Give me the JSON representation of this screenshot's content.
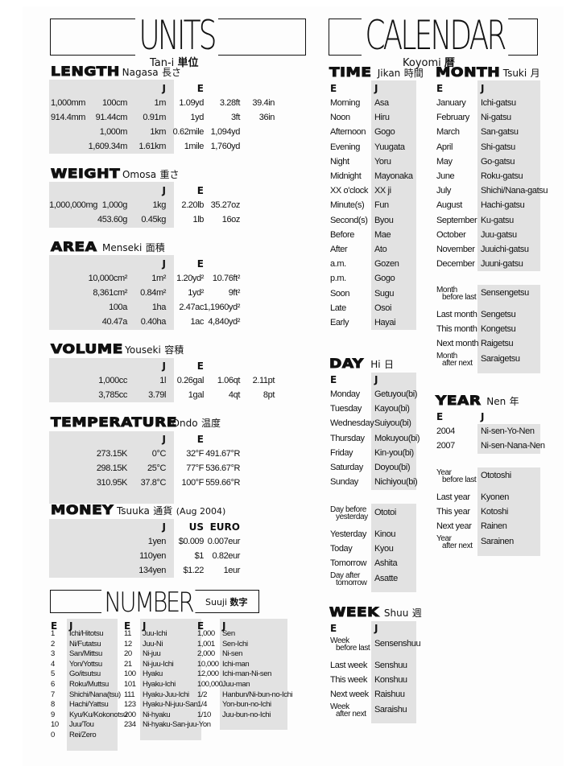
{
  "units": {
    "title": "UNITS",
    "subtitle_romaji": "Tan-i",
    "subtitle_kanji": "単位",
    "length": {
      "heading": "LENGTH",
      "romaji": "Nagasa",
      "kanji": "長さ",
      "col_j": "J",
      "col_e": "E",
      "rows": [
        [
          "1,000mm",
          "100cm",
          "1m",
          "1.09yd",
          "3.28ft",
          "39.4in"
        ],
        [
          "914.4mm",
          "91.44cm",
          "0.91m",
          "1yd",
          "3ft",
          "36in"
        ],
        [
          "",
          "1,000m",
          "1km",
          "0.62mile",
          "1,094yd",
          ""
        ],
        [
          "",
          "1,609.34m",
          "1.61km",
          "1mile",
          "1,760yd",
          ""
        ]
      ]
    },
    "weight": {
      "heading": "WEIGHT",
      "romaji": "Omosa",
      "kanji": "重さ",
      "col_j": "J",
      "col_e": "E",
      "rows": [
        [
          "1,000,000mg",
          "1,000g",
          "1kg",
          "2.20lb",
          "35.27oz"
        ],
        [
          "",
          "453.60g",
          "0.45kg",
          "1lb",
          "16oz"
        ]
      ]
    },
    "area": {
      "heading": "AREA",
      "romaji": "Menseki",
      "kanji": "面積",
      "col_j": "J",
      "col_e": "E",
      "rows": [
        [
          "10,000cm²",
          "1m²",
          "1.20yd²",
          "10.76ft²"
        ],
        [
          "8,361cm²",
          "0.84m²",
          "1yd²",
          "9ft²"
        ],
        [
          "100a",
          "1ha",
          "2.47ac",
          "1,1960yd²"
        ],
        [
          "40.47a",
          "0.40ha",
          "1ac",
          "4,840yd²"
        ]
      ]
    },
    "volume": {
      "heading": "VOLUME",
      "romaji": "Youseki",
      "kanji": "容積",
      "col_j": "J",
      "col_e": "E",
      "rows": [
        [
          "1,000cc",
          "1l",
          "0.26gal",
          "1.06qt",
          "2.11pt"
        ],
        [
          "3,785cc",
          "3.79l",
          "1gal",
          "4qt",
          "8pt"
        ]
      ]
    },
    "temperature": {
      "heading": "TEMPERATURE",
      "romaji": "Ondo",
      "kanji": "温度",
      "col_j": "J",
      "col_e": "E",
      "rows": [
        [
          "273.15K",
          "0°C",
          "32°F",
          "491.67°R"
        ],
        [
          "298.15K",
          "25°C",
          "77°F",
          "536.67°R"
        ],
        [
          "310.95K",
          "37.8°C",
          "100°F",
          "559.66°R"
        ]
      ]
    },
    "money": {
      "heading": "MONEY",
      "romaji": "Tsuuka",
      "kanji": "通貨",
      "note": "(Aug 2004)",
      "col_j": "J",
      "col_us": "US",
      "col_euro": "EURO",
      "rows": [
        [
          "1yen",
          "$0.009",
          "0.007eur"
        ],
        [
          "110yen",
          "$1",
          "0.82eur"
        ],
        [
          "134yen",
          "$1.22",
          "1eur"
        ]
      ]
    }
  },
  "number": {
    "title": "NUMBER",
    "romaji": "Suuji",
    "kanji": "数字",
    "col_e": "E",
    "col_j": "J",
    "col1": [
      [
        "1",
        "Ichi/Hitotsu"
      ],
      [
        "2",
        "Ni/Futatsu"
      ],
      [
        "3",
        "San/Mittsu"
      ],
      [
        "4",
        "Yon/Yottsu"
      ],
      [
        "5",
        "Go/itsutsu"
      ],
      [
        "6",
        "Roku/Muttsu"
      ],
      [
        "7",
        "Shichi/Nana(tsu)"
      ],
      [
        "8",
        "Hachi/Yattsu"
      ],
      [
        "9",
        "Kyu/Ku/Kokonotsu"
      ],
      [
        "10",
        "Juu/Tou"
      ],
      [
        "0",
        "Rei/Zero"
      ]
    ],
    "col2": [
      [
        "11",
        "Juu-Ichi"
      ],
      [
        "12",
        "Juu-Ni"
      ],
      [
        "20",
        "Ni-juu"
      ],
      [
        "21",
        "Ni-juu-Ichi"
      ],
      [
        "100",
        "Hyaku"
      ],
      [
        "101",
        "Hyaku-Ichi"
      ],
      [
        "111",
        "Hyaku-Juu-Ichi"
      ],
      [
        "123",
        "Hyaku-Ni-juu-San"
      ],
      [
        "200",
        "Ni-hyaku"
      ],
      [
        "234",
        "Ni-hyaku-San-juu-Yon"
      ]
    ],
    "col3": [
      [
        "1,000",
        "Sen"
      ],
      [
        "1,001",
        "Sen-Ichi"
      ],
      [
        "2,000",
        "Ni-sen"
      ],
      [
        "10,000",
        "Ichi-man"
      ],
      [
        "12,000",
        "Ichi-man-Ni-sen"
      ],
      [
        "100,000",
        "Juu-man"
      ],
      [
        "1/2",
        "Hanbun/Ni-bun-no-Ichi"
      ],
      [
        "1/4",
        "Yon-bun-no-Ichi"
      ],
      [
        "1/10",
        "Juu-bun-no-Ichi"
      ]
    ]
  },
  "calendar": {
    "title": "CALENDAR",
    "subtitle_romaji": "Koyomi",
    "subtitle_kanji": "暦",
    "time": {
      "heading": "TIME",
      "romaji": "Jikan",
      "kanji": "時間",
      "col_e": "E",
      "col_j": "J",
      "rows": [
        [
          "Morning",
          "Asa"
        ],
        [
          "Noon",
          "Hiru"
        ],
        [
          "Afternoon",
          "Gogo"
        ],
        [
          "Evening",
          "Yuugata"
        ],
        [
          "Night",
          "Yoru"
        ],
        [
          "Midnight",
          "Mayonaka"
        ],
        [
          "XX o'clock",
          "XX ji"
        ],
        [
          "Minute(s)",
          "Fun"
        ],
        [
          "Second(s)",
          "Byou"
        ],
        [
          "Before",
          "Mae"
        ],
        [
          "After",
          "Ato"
        ],
        [
          "a.m.",
          "Gozen"
        ],
        [
          "p.m.",
          "Gogo"
        ],
        [
          "Soon",
          "Sugu"
        ],
        [
          "Late",
          "Osoi"
        ],
        [
          "Early",
          "Hayai"
        ]
      ]
    },
    "month": {
      "heading": "MONTH",
      "romaji": "Tsuki",
      "kanji": "月",
      "col_e": "E",
      "col_j": "J",
      "rows": [
        [
          "January",
          "Ichi-gatsu"
        ],
        [
          "February",
          "Ni-gatsu"
        ],
        [
          "March",
          "San-gatsu"
        ],
        [
          "April",
          "Shi-gatsu"
        ],
        [
          "May",
          "Go-gatsu"
        ],
        [
          "June",
          "Roku-gatsu"
        ],
        [
          "July",
          "Shichi/Nana-gatsu"
        ],
        [
          "August",
          "Hachi-gatsu"
        ],
        [
          "September",
          "Ku-gatsu"
        ],
        [
          "October",
          "Juu-gatsu"
        ],
        [
          "November",
          "Juuichi-gatsu"
        ],
        [
          "December",
          "Juuni-gatsu"
        ]
      ],
      "relative": [
        {
          "e1": "Month",
          "e2": "before last",
          "j": "Sensengetsu"
        },
        {
          "e1": "Last month",
          "e2": "",
          "j": "Sengetsu"
        },
        {
          "e1": "This month",
          "e2": "",
          "j": "Kongetsu"
        },
        {
          "e1": "Next month",
          "e2": "",
          "j": "Raigetsu"
        },
        {
          "e1": "Month",
          "e2": "after next",
          "j": "Saraigetsu"
        }
      ]
    },
    "day": {
      "heading": "DAY",
      "romaji": "Hi",
      "kanji": "日",
      "col_e": "E",
      "col_j": "J",
      "rows": [
        [
          "Monday",
          "Getuyou(bi)"
        ],
        [
          "Tuesday",
          "Kayou(bi)"
        ],
        [
          "Wednesday",
          "Suiyou(bi)"
        ],
        [
          "Thursday",
          "Mokuyou(bi)"
        ],
        [
          "Friday",
          "Kin-you(bi)"
        ],
        [
          "Saturday",
          "Doyou(bi)"
        ],
        [
          "Sunday",
          "Nichiyou(bi)"
        ]
      ],
      "relative": [
        {
          "e1": "Day before",
          "e2": "yesterday",
          "j": "Ototoi"
        },
        {
          "e1": "Yesterday",
          "e2": "",
          "j": "Kinou"
        },
        {
          "e1": "Today",
          "e2": "",
          "j": "Kyou"
        },
        {
          "e1": "Tomorrow",
          "e2": "",
          "j": "Ashita"
        },
        {
          "e1": "Day after",
          "e2": "tomorrow",
          "j": "Asatte"
        }
      ]
    },
    "year": {
      "heading": "YEAR",
      "romaji": "Nen",
      "kanji": "年",
      "col_e": "E",
      "col_j": "J",
      "rows": [
        [
          "2004",
          "Ni-sen-Yo-Nen"
        ],
        [
          "2007",
          "Ni-sen-Nana-Nen"
        ]
      ],
      "relative": [
        {
          "e1": "Year",
          "e2": "before last",
          "j": "Ototoshi"
        },
        {
          "e1": "Last year",
          "e2": "",
          "j": "Kyonen"
        },
        {
          "e1": "This year",
          "e2": "",
          "j": "Kotoshi"
        },
        {
          "e1": "Next year",
          "e2": "",
          "j": "Rainen"
        },
        {
          "e1": "Year",
          "e2": "after next",
          "j": "Sarainen"
        }
      ]
    },
    "week": {
      "heading": "WEEK",
      "romaji": "Shuu",
      "kanji": "週",
      "col_e": "E",
      "col_j": "J",
      "relative": [
        {
          "e1": "Week",
          "e2": "before last",
          "j": "Sensenshuu"
        },
        {
          "e1": "Last week",
          "e2": "",
          "j": "Senshuu"
        },
        {
          "e1": "This week",
          "e2": "",
          "j": "Konshuu"
        },
        {
          "e1": "Next week",
          "e2": "",
          "j": "Raishuu"
        },
        {
          "e1": "Week",
          "e2": "after next",
          "j": "Saraishu"
        }
      ]
    }
  }
}
